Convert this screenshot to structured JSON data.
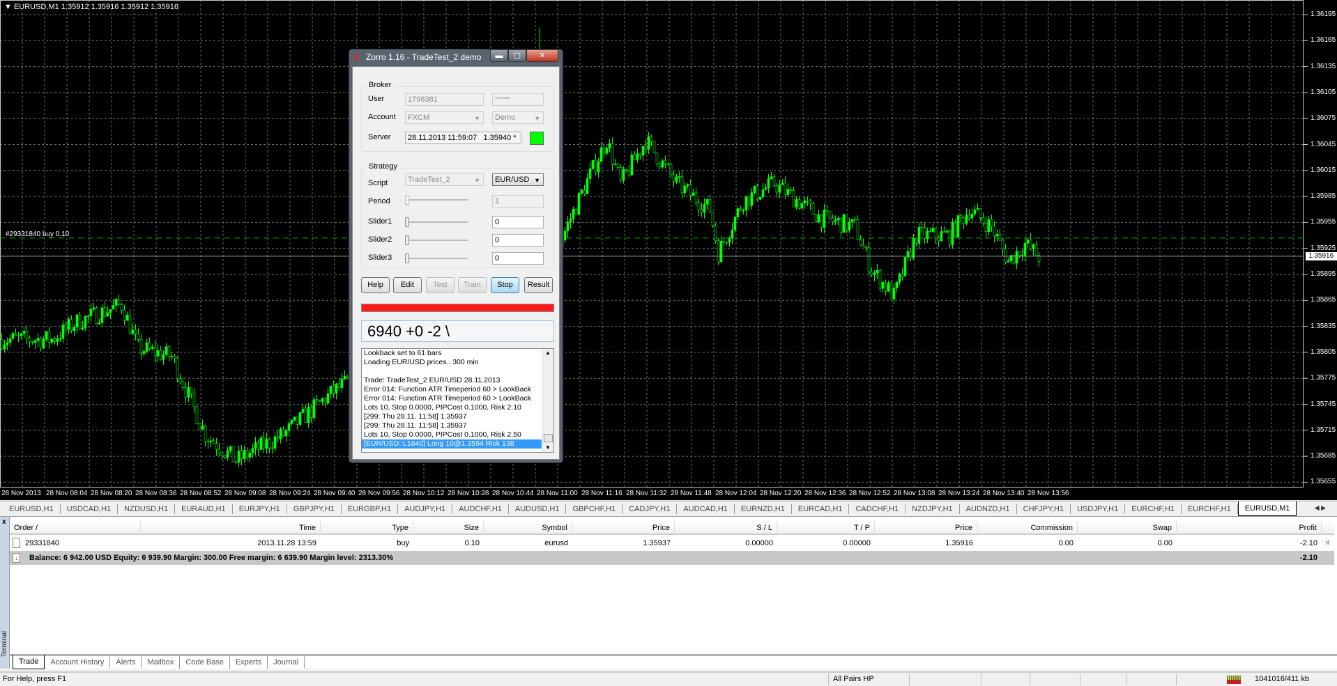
{
  "chart": {
    "title": "EURUSD,M1  1.35912 1.35916 1.35912 1.35916",
    "order_line_label": "#29331840 buy 0.10",
    "bid_price": "1.35916",
    "colors": {
      "background": "#000000",
      "candle": "#00ff00",
      "grid": "#6a6a6a",
      "order_line": "#00c000",
      "bid_line": "#a0a0a0"
    },
    "price_labels": [
      "1.36195",
      "1.36165",
      "1.36135",
      "1.36105",
      "1.36075",
      "1.36045",
      "1.36015",
      "1.35985",
      "1.35955",
      "1.35925",
      "1.35895",
      "1.35865",
      "1.35835",
      "1.35805",
      "1.35775",
      "1.35745",
      "1.35715",
      "1.35685",
      "1.35655"
    ],
    "time_labels": [
      "28 Nov 2013",
      "28 Nov 08:04",
      "28 Nov 08:20",
      "28 Nov 08:36",
      "28 Nov 08:52",
      "28 Nov 09:08",
      "28 Nov 09:24",
      "28 Nov 09:40",
      "28 Nov 09:56",
      "28 Nov 10:12",
      "28 Nov 10:28",
      "28 Nov 10:44",
      "28 Nov 11:00",
      "28 Nov 11:16",
      "28 Nov 11:32",
      "28 Nov 11:48",
      "28 Nov 12:04",
      "28 Nov 12:20",
      "28 Nov 12:36",
      "28 Nov 12:52",
      "28 Nov 13:08",
      "28 Nov 13:24",
      "28 Nov 13:40",
      "28 Nov 13:56"
    ]
  },
  "chart_data": {
    "type": "candlestick",
    "timeframe": "M1",
    "symbol": "EURUSD",
    "ylim": [
      1.3564,
      1.3621
    ],
    "grid": true,
    "order_price": 1.35937,
    "bid": 1.35916,
    "price_path": [
      {
        "t": "07:48",
        "p": 1.3582
      },
      {
        "t": "08:06",
        "p": 1.3582
      },
      {
        "t": "08:15",
        "p": 1.3584
      },
      {
        "t": "08:31",
        "p": 1.3586
      },
      {
        "t": "08:37",
        "p": 1.3581
      },
      {
        "t": "08:49",
        "p": 1.358
      },
      {
        "t": "09:01",
        "p": 1.3571
      },
      {
        "t": "09:12",
        "p": 1.3568
      },
      {
        "t": "09:29",
        "p": 1.3571
      },
      {
        "t": "09:47",
        "p": 1.3576
      },
      {
        "t": "10:06",
        "p": 1.358
      },
      {
        "t": "10:36",
        "p": 1.3585
      },
      {
        "t": "11:04",
        "p": 1.359
      },
      {
        "t": "11:12",
        "p": 1.3596
      },
      {
        "t": "11:19",
        "p": 1.3601
      },
      {
        "t": "11:25",
        "p": 1.3605
      },
      {
        "t": "11:30",
        "p": 1.36
      },
      {
        "t": "11:39",
        "p": 1.3605
      },
      {
        "t": "11:50",
        "p": 1.36
      },
      {
        "t": "12:02",
        "p": 1.3597
      },
      {
        "t": "12:05",
        "p": 1.3592
      },
      {
        "t": "12:14",
        "p": 1.3598
      },
      {
        "t": "12:25",
        "p": 1.36
      },
      {
        "t": "12:42",
        "p": 1.3596
      },
      {
        "t": "12:54",
        "p": 1.3595
      },
      {
        "t": "13:00",
        "p": 1.359
      },
      {
        "t": "13:08",
        "p": 1.3587
      },
      {
        "t": "13:16",
        "p": 1.3594
      },
      {
        "t": "13:28",
        "p": 1.3594
      },
      {
        "t": "13:35",
        "p": 1.3597
      },
      {
        "t": "13:43",
        "p": 1.3595
      },
      {
        "t": "13:49",
        "p": 1.3591
      },
      {
        "t": "13:55",
        "p": 1.3593
      },
      {
        "t": "14:00",
        "p": 1.35916
      }
    ],
    "spikes": [
      {
        "t": "11:01",
        "high": 1.3618
      }
    ]
  },
  "dialog": {
    "title": "Zorro 1.16 - TradeTest_2 demo",
    "broker_label": "Broker",
    "user_label": "User",
    "user_value": "1798381",
    "password_value": "*******",
    "account_label": "Account",
    "account_value": "FXCM",
    "account_type": "Demo",
    "server_label": "Server",
    "server_value": "28.11.2013 11:59:07   1.35940 *",
    "server_status_color": "#00ff00",
    "strategy_label": "Strategy",
    "script_label": "Script",
    "script_value": "TradeTest_2",
    "asset_value": "EUR/USD",
    "period_label": "Period",
    "period_value": "1",
    "sliders": [
      {
        "label": "Slider1",
        "value": "0"
      },
      {
        "label": "Slider2",
        "value": "0"
      },
      {
        "label": "Slider3",
        "value": "0"
      }
    ],
    "buttons": {
      "help": "Help",
      "edit": "Edit",
      "test": "Test",
      "train": "Train",
      "stop": "Stop",
      "result": "Result"
    },
    "progress_color": "#ff1a1a",
    "status_text": "6940 +0 -2 \\",
    "log": [
      "Lookback set to 61 bars",
      "Loading EUR/USD prices.. 300 min",
      "",
      "Trade: TradeTest_2 EUR/USD 28.11.2013",
      "Error 014: Function ATR Timeperiod 60 > LookBack",
      "Error 014: Function ATR Timeperiod 60 > LookBack",
      "Lots 10, Stop 0.0000, PIPCost 0.1000, Risk 2.10",
      "[299: Thu 28.11. 11:58]  1.35937",
      "[299: Thu 28.11. 11:58]  1.35937",
      "Lots 10, Stop 0.0000, PIPCost 0.1000, Risk 2.50",
      "[EUR/USD::L1840] Long 10@1.3594 Risk 138"
    ]
  },
  "symbol_tabs": [
    "EURUSD,H1",
    "USDCAD,H1",
    "NZDUSD,H1",
    "EURAUD,H1",
    "EURJPY,H1",
    "GBPJPY,H1",
    "EURGBP,H1",
    "AUDJPY,H1",
    "AUDCHF,H1",
    "AUDUSD,H1",
    "GBPCHF,H1",
    "CADJPY,H1",
    "AUDCAD,H1",
    "EURNZD,H1",
    "EURCAD,H1",
    "CADCHF,H1",
    "NZDJPY,H1",
    "AUDNZD,H1",
    "CHFJPY,H1",
    "USDJPY,H1",
    "EURCHF,H1",
    "EURCHF,H1",
    "EURUSD,M1"
  ],
  "terminal": {
    "strip_label": "Terminal",
    "columns": [
      "Order  /",
      "Time",
      "Type",
      "Size",
      "Symbol",
      "Price",
      "S / L",
      "T / P",
      "Price",
      "Commission",
      "Swap",
      "Profit"
    ],
    "orders": [
      [
        "29331840",
        "2013.11.28 13:59",
        "buy",
        "0.10",
        "eurusd",
        "1.35937",
        "0.00000",
        "0.00000",
        "1.35916",
        "0.00",
        "0.00",
        "-2.10"
      ]
    ],
    "balance_text": "Balance: 6 942.00 USD  Equity: 6 939.90  Margin: 300.00  Free margin: 6 639.90  Margin level: 2313.30%",
    "total_profit": "-2.10",
    "tabs": [
      "Trade",
      "Account History",
      "Alerts",
      "Mailbox",
      "Code Base",
      "Experts",
      "Journal"
    ]
  },
  "status_bar": {
    "help": "For Help, press F1",
    "profile": "All Pairs HP",
    "traffic": "1041016/411 kb"
  }
}
